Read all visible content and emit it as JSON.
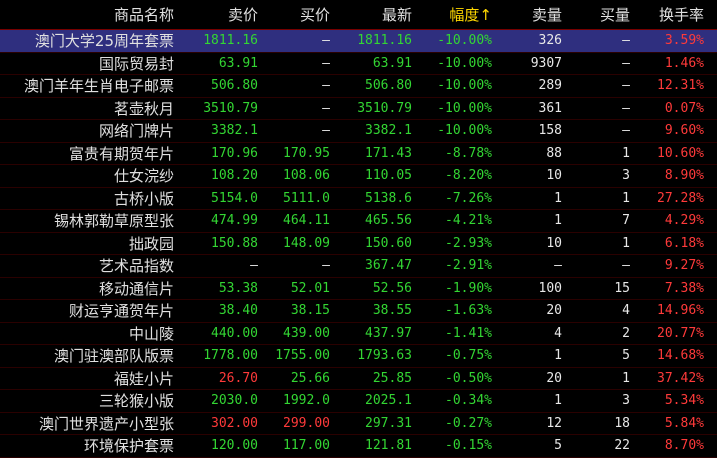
{
  "colors": {
    "green": "#33d633",
    "red": "#ff3a3a",
    "white": "#e8e8e8",
    "header": "#e0e0e0",
    "sort": "#ffd800",
    "selected_bg": "#2f2f7f"
  },
  "header": {
    "name": "商品名称",
    "sell": "卖价",
    "buy": "买价",
    "last": "最新",
    "chg": "幅度↑",
    "sell_vol": "卖量",
    "buy_vol": "买量",
    "turnover": "换手率"
  },
  "rows": [
    {
      "name": "澳门大学25周年套票",
      "sell": "1811.16",
      "buy": "—",
      "last": "1811.16",
      "chg": "-10.00%",
      "sell_vol": "326",
      "buy_vol": "—",
      "turnover": "3.59%",
      "sell_c": "g",
      "buy_c": "w",
      "last_c": "g",
      "turn_c": "r",
      "selected": true
    },
    {
      "name": "国际贸易封",
      "sell": "63.91",
      "buy": "—",
      "last": "63.91",
      "chg": "-10.00%",
      "sell_vol": "9307",
      "buy_vol": "—",
      "turnover": "1.46%",
      "sell_c": "g",
      "buy_c": "w",
      "last_c": "g",
      "turn_c": "r"
    },
    {
      "name": "澳门羊年生肖电子邮票",
      "sell": "506.80",
      "buy": "—",
      "last": "506.80",
      "chg": "-10.00%",
      "sell_vol": "289",
      "buy_vol": "—",
      "turnover": "12.31%",
      "sell_c": "g",
      "buy_c": "w",
      "last_c": "g",
      "turn_c": "r"
    },
    {
      "name": "茗壶秋月",
      "sell": "3510.79",
      "buy": "—",
      "last": "3510.79",
      "chg": "-10.00%",
      "sell_vol": "361",
      "buy_vol": "—",
      "turnover": "0.07%",
      "sell_c": "g",
      "buy_c": "w",
      "last_c": "g",
      "turn_c": "r"
    },
    {
      "name": "网络门牌片",
      "sell": "3382.1",
      "buy": "—",
      "last": "3382.1",
      "chg": "-10.00%",
      "sell_vol": "158",
      "buy_vol": "—",
      "turnover": "9.60%",
      "sell_c": "g",
      "buy_c": "w",
      "last_c": "g",
      "turn_c": "r"
    },
    {
      "name": "富贵有期贺年片",
      "sell": "170.96",
      "buy": "170.95",
      "last": "171.43",
      "chg": "-8.78%",
      "sell_vol": "88",
      "buy_vol": "1",
      "turnover": "10.60%",
      "sell_c": "g",
      "buy_c": "g",
      "last_c": "g",
      "turn_c": "r"
    },
    {
      "name": "仕女浣纱",
      "sell": "108.20",
      "buy": "108.06",
      "last": "110.05",
      "chg": "-8.20%",
      "sell_vol": "10",
      "buy_vol": "3",
      "turnover": "8.90%",
      "sell_c": "g",
      "buy_c": "g",
      "last_c": "g",
      "turn_c": "r"
    },
    {
      "name": "古桥小版",
      "sell": "5154.0",
      "buy": "5111.0",
      "last": "5138.6",
      "chg": "-7.26%",
      "sell_vol": "1",
      "buy_vol": "1",
      "turnover": "27.28%",
      "sell_c": "g",
      "buy_c": "g",
      "last_c": "g",
      "turn_c": "r"
    },
    {
      "name": "锡林郭勒草原型张",
      "sell": "474.99",
      "buy": "464.11",
      "last": "465.56",
      "chg": "-4.21%",
      "sell_vol": "1",
      "buy_vol": "7",
      "turnover": "4.29%",
      "sell_c": "g",
      "buy_c": "g",
      "last_c": "g",
      "turn_c": "r"
    },
    {
      "name": "拙政园",
      "sell": "150.88",
      "buy": "148.09",
      "last": "150.60",
      "chg": "-2.93%",
      "sell_vol": "10",
      "buy_vol": "1",
      "turnover": "6.18%",
      "sell_c": "g",
      "buy_c": "g",
      "last_c": "g",
      "turn_c": "r"
    },
    {
      "name": "艺术品指数",
      "sell": "—",
      "buy": "—",
      "last": "367.47",
      "chg": "-2.91%",
      "sell_vol": "—",
      "buy_vol": "—",
      "turnover": "9.27%",
      "sell_c": "w",
      "buy_c": "w",
      "last_c": "g",
      "turn_c": "r"
    },
    {
      "name": "移动通信片",
      "sell": "53.38",
      "buy": "52.01",
      "last": "52.56",
      "chg": "-1.90%",
      "sell_vol": "100",
      "buy_vol": "15",
      "turnover": "7.38%",
      "sell_c": "g",
      "buy_c": "g",
      "last_c": "g",
      "turn_c": "r"
    },
    {
      "name": "财运亨通贺年片",
      "sell": "38.40",
      "buy": "38.15",
      "last": "38.55",
      "chg": "-1.63%",
      "sell_vol": "20",
      "buy_vol": "4",
      "turnover": "14.96%",
      "sell_c": "g",
      "buy_c": "g",
      "last_c": "g",
      "turn_c": "r"
    },
    {
      "name": "中山陵",
      "sell": "440.00",
      "buy": "439.00",
      "last": "437.97",
      "chg": "-1.41%",
      "sell_vol": "4",
      "buy_vol": "2",
      "turnover": "20.77%",
      "sell_c": "g",
      "buy_c": "g",
      "last_c": "g",
      "turn_c": "r"
    },
    {
      "name": "澳门驻澳部队版票",
      "sell": "1778.00",
      "buy": "1755.00",
      "last": "1793.63",
      "chg": "-0.75%",
      "sell_vol": "1",
      "buy_vol": "5",
      "turnover": "14.68%",
      "sell_c": "g",
      "buy_c": "g",
      "last_c": "g",
      "turn_c": "r"
    },
    {
      "name": "福娃小片",
      "sell": "26.70",
      "buy": "25.66",
      "last": "25.85",
      "chg": "-0.50%",
      "sell_vol": "20",
      "buy_vol": "1",
      "turnover": "37.42%",
      "sell_c": "r",
      "buy_c": "g",
      "last_c": "g",
      "turn_c": "r"
    },
    {
      "name": "三轮猴小版",
      "sell": "2030.0",
      "buy": "1992.0",
      "last": "2025.1",
      "chg": "-0.34%",
      "sell_vol": "1",
      "buy_vol": "3",
      "turnover": "5.34%",
      "sell_c": "g",
      "buy_c": "g",
      "last_c": "g",
      "turn_c": "r"
    },
    {
      "name": "澳门世界遗产小型张",
      "sell": "302.00",
      "buy": "299.00",
      "last": "297.31",
      "chg": "-0.27%",
      "sell_vol": "12",
      "buy_vol": "18",
      "turnover": "5.84%",
      "sell_c": "r",
      "buy_c": "r",
      "last_c": "g",
      "turn_c": "r"
    },
    {
      "name": "环境保护套票",
      "sell": "120.00",
      "buy": "117.00",
      "last": "121.81",
      "chg": "-0.15%",
      "sell_vol": "5",
      "buy_vol": "22",
      "turnover": "8.70%",
      "sell_c": "g",
      "buy_c": "g",
      "last_c": "g",
      "turn_c": "r"
    }
  ]
}
